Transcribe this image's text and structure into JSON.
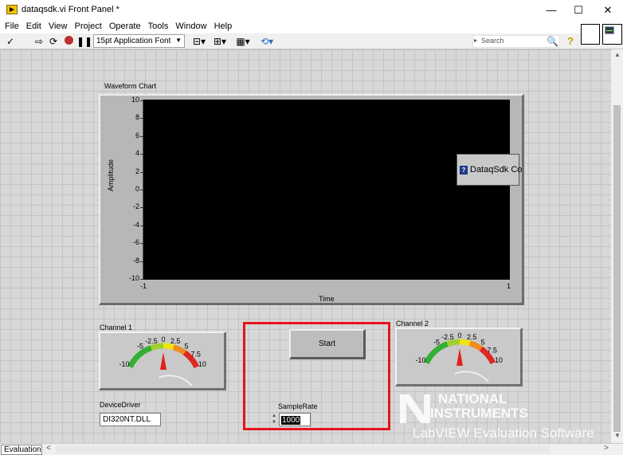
{
  "window": {
    "title": "dataqsdk.vi Front Panel *",
    "minimize": "—",
    "maximize": "☐",
    "close": "✕"
  },
  "menu": [
    "File",
    "Edit",
    "View",
    "Project",
    "Operate",
    "Tools",
    "Window",
    "Help"
  ],
  "toolbar": {
    "font_select": "15pt Application Font",
    "search_placeholder": "Search",
    "icons": [
      "run-arrow-icon",
      "run-continuous-icon",
      "abort-icon",
      "pause-icon",
      "align-icon",
      "distribute-icon",
      "resize-icon",
      "reorder-icon",
      "search-icon",
      "help-icon"
    ]
  },
  "waveform_chart": {
    "label": "Waveform Chart",
    "ylabel": "Amplitude",
    "xlabel": "Time",
    "plot_background": "#000000"
  },
  "chart_data": {
    "type": "line",
    "title": "Waveform Chart",
    "xlabel": "Time",
    "ylabel": "Amplitude",
    "xlim": [
      -1,
      1
    ],
    "ylim": [
      -10,
      10
    ],
    "y_ticks": [
      "10",
      "8",
      "6",
      "4",
      "2",
      "0",
      "-2",
      "-4",
      "-6",
      "-8",
      "-10"
    ],
    "x_ticks": [
      "-1",
      "1"
    ],
    "series": [],
    "grid": false
  },
  "dll_node": {
    "label": "DataqSdk Co"
  },
  "channel1": {
    "label": "Channel 1",
    "ticks": [
      "-10",
      "-5",
      "-2.5",
      "0",
      "2.5",
      "5",
      "7.5",
      "10"
    ],
    "value": 0
  },
  "channel2": {
    "label": "Channel 2",
    "ticks": [
      "-10",
      "-5",
      "-2.5",
      "0",
      "2.5",
      "5",
      "7.5",
      "10"
    ],
    "value": 0
  },
  "start_button": {
    "label": "Start"
  },
  "device_driver": {
    "label": "DeviceDriver",
    "value": "DI320NT.DLL"
  },
  "sample_rate": {
    "label": "SampleRate",
    "value": "1000"
  },
  "watermark": {
    "line1": "NATIONAL",
    "line2": "INSTRUMENTS",
    "line3": "LabVIEW Evaluation Software"
  },
  "status": {
    "tab": "Evaluation"
  },
  "colors": {
    "highlight": "#e8141c",
    "panel": "#d7d7d7",
    "gauge_low": "#2fae2f",
    "gauge_mid": "#f2e30c",
    "gauge_high": "#e0221c",
    "needle": "#e0221c"
  }
}
